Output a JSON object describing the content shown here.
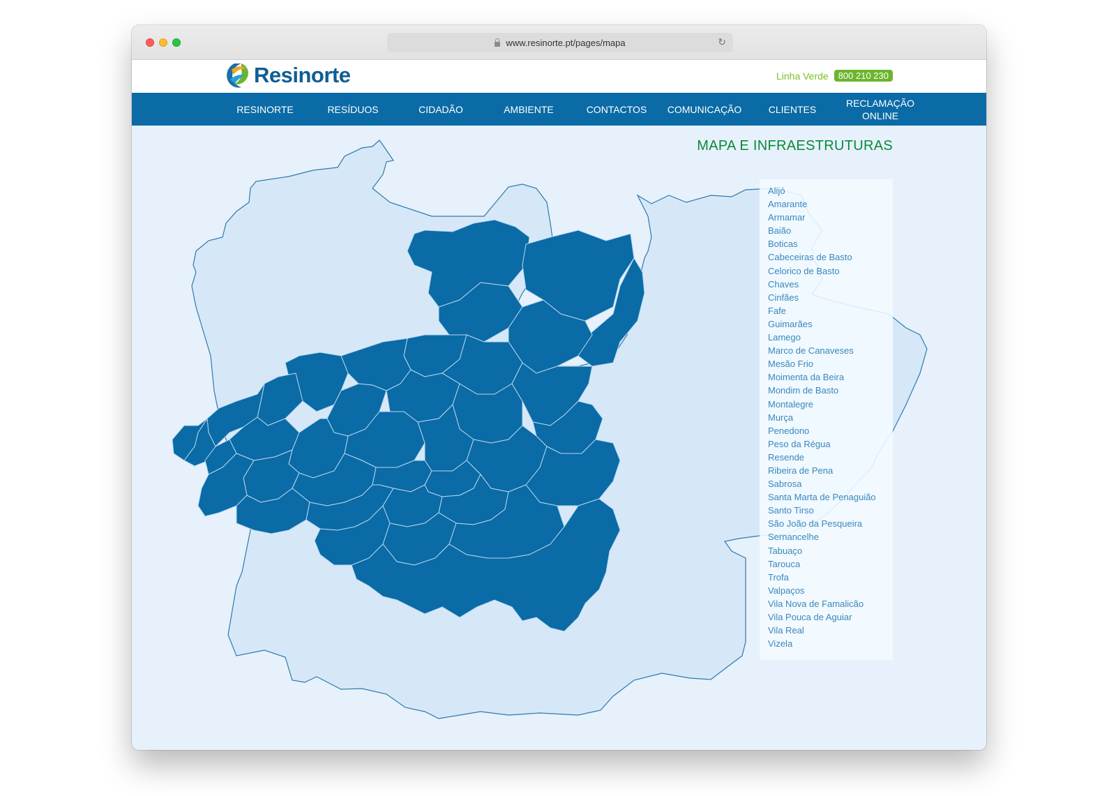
{
  "browser": {
    "url": "www.resinorte.pt/pages/mapa"
  },
  "header": {
    "logo_text": "Resinorte",
    "hotline_label": "Linha Verde",
    "hotline_number": "800 210 230"
  },
  "nav": {
    "items": [
      {
        "label": "RESINORTE"
      },
      {
        "label": "RESÍDUOS"
      },
      {
        "label": "CIDADÃO"
      },
      {
        "label": "AMBIENTE"
      },
      {
        "label": "CONTACTOS"
      },
      {
        "label": "COMUNICAÇÃO"
      },
      {
        "label": "CLIENTES"
      },
      {
        "label": "RECLAMAÇÃO\nONLINE"
      }
    ]
  },
  "page": {
    "title": "MAPA E INFRAESTRUTURAS"
  },
  "municipalities": [
    "Alijó",
    "Amarante",
    "Armamar",
    "Baião",
    "Boticas",
    "Cabeceiras de Basto",
    "Celorico de Basto",
    "Chaves",
    "Cinfães",
    "Fafe",
    "Guimarães",
    "Lamego",
    "Marco de Canaveses",
    "Mesão Frio",
    "Moimenta da Beira",
    "Mondim de Basto",
    "Montalegre",
    "Murça",
    "Penedono",
    "Peso da Régua",
    "Resende",
    "Ribeira de Pena",
    "Sabrosa",
    "Santa Marta de Penaguião",
    "Santo Tirso",
    "São João da Pesqueira",
    "Sernancelhe",
    "Tabuaço",
    "Tarouca",
    "Trofa",
    "Valpaços",
    "Vila Nova de Famalicão",
    "Vila Pouca de Aguiar",
    "Vila Real",
    "Vizela"
  ],
  "colors": {
    "nav_bg": "#0a6ba6",
    "region_fill": "#0a6ba6",
    "map_bg": "#e6f1fb",
    "land_fill": "#d6e8f8",
    "title": "#0a8a3a",
    "hotline": "#6cb52d"
  }
}
